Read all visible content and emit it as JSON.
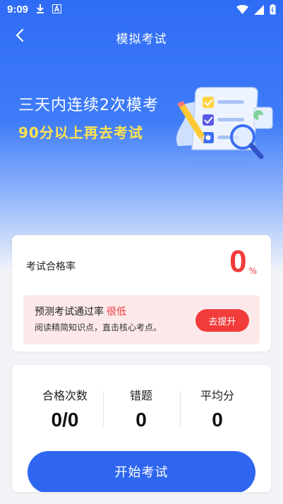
{
  "status_bar": {
    "time": "9:09",
    "icons_left": [
      "download-icon",
      "a-badge-icon"
    ],
    "icons_right": [
      "wifi-icon",
      "signal-icon",
      "battery-icon"
    ]
  },
  "nav": {
    "title": "模拟考试",
    "back_icon": "chevron-left-icon"
  },
  "hero": {
    "line1": "三天内连续2次模考",
    "line2": "90分以上再去考试"
  },
  "pass_card": {
    "label": "考试合格率",
    "value": "0",
    "unit": "%",
    "predict_text": "预测考试通过率",
    "predict_level": "很低",
    "tip": "阅读精简知识点，直击核心考点。",
    "button": "去提升"
  },
  "stats": {
    "items": [
      {
        "label": "合格次数",
        "value": "0/0"
      },
      {
        "label": "错题",
        "value": "0"
      },
      {
        "label": "平均分",
        "value": "0"
      }
    ],
    "start_button": "开始考试"
  },
  "colors": {
    "primary": "#2f66f0",
    "danger": "#f03a3a",
    "highlight": "#ffe34d"
  }
}
